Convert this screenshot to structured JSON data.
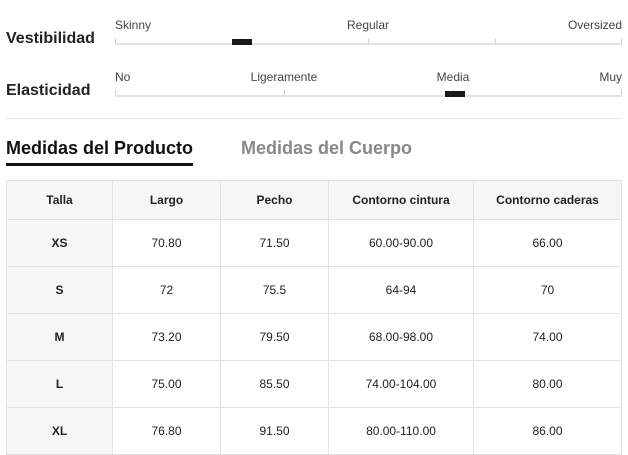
{
  "fit": {
    "rows": [
      {
        "title": "Vestibilidad",
        "labels": [
          "Skinny",
          "Regular",
          "Oversized"
        ],
        "position": 0.25
      },
      {
        "title": "Elasticidad",
        "labels": [
          "No",
          "Ligeramente",
          "Media",
          "Muy"
        ],
        "position": 0.67
      }
    ]
  },
  "tabs": {
    "product": "Medidas del Producto",
    "body": "Medidas del Cuerpo",
    "active": "product"
  },
  "table": {
    "headers": [
      "Talla",
      "Largo",
      "Pecho",
      "Contorno cintura",
      "Contorno caderas"
    ],
    "rows": [
      [
        "XS",
        "70.80",
        "71.50",
        "60.00-90.00",
        "66.00"
      ],
      [
        "S",
        "72",
        "75.5",
        "64-94",
        "70"
      ],
      [
        "M",
        "73.20",
        "79.50",
        "68.00-98.00",
        "74.00"
      ],
      [
        "L",
        "75.00",
        "85.50",
        "74.00-104.00",
        "80.00"
      ],
      [
        "XL",
        "76.80",
        "91.50",
        "80.00-110.00",
        "86.00"
      ]
    ]
  }
}
